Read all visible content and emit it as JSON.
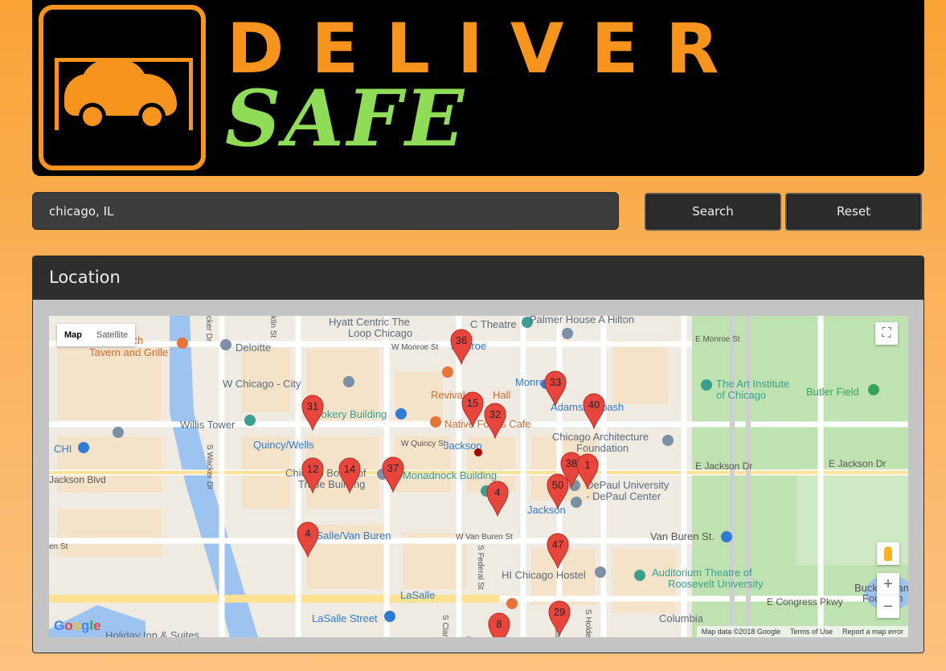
{
  "brand": {
    "line1": "DELIVER",
    "line2": "SAFE",
    "primary_color": "#f7941d",
    "secondary_color": "#8fdc56"
  },
  "search": {
    "value": "chicago, IL",
    "search_label": "Search",
    "reset_label": "Reset"
  },
  "panel": {
    "title": "Location"
  },
  "map": {
    "type_map": "Map",
    "type_satellite": "Satellite",
    "google": "Google",
    "attribution": {
      "data": "Map data ©2018 Google",
      "terms": "Terms of Use",
      "report": "Report a map error"
    },
    "zoom_in": "+",
    "zoom_out": "−",
    "place_labels": [
      "Hyatt Centric The",
      "Loop Chicago",
      "W Monroe St",
      "Monroe",
      "C Theatre",
      "Palmer House A Hilton",
      "Branch",
      "Tavern and Grille",
      "Deloitte",
      "W Chicago - City",
      "Revival",
      "Hall",
      "Monroe",
      "Adams/Wabash",
      "The Art Institute",
      "of Chicago",
      "Butler Field",
      "Rookery Building",
      "Native Foods Cafe",
      "Willis Tower",
      "Chicago Architecture",
      "Foundation",
      "Quincy/Wells",
      "W Quincy St",
      "Jackson",
      "E Jackson Dr",
      "E Jackson Dr",
      "Chicago Board of",
      "Trade Building",
      "Monadnock Building",
      "DePaul University",
      "- DePaul Center",
      "Jackson Blvd",
      "Jackson",
      "LaSalle/Van Buren",
      "W Van Buren St",
      "Van Buren St.",
      "HI Chicago Hostel",
      "Auditorium Theatre of",
      "Roosevelt University",
      "LaSalle",
      "E Congress Pkwy",
      "LaSalle Street",
      "Columbia",
      "Holiday Inn & Suites",
      "Buckingham",
      "Fountain",
      "S Wacker Dr",
      "S Federal St",
      "S Clark St",
      "S State St",
      "S Holden",
      "E Monroe St",
      "CHI",
      "en St",
      "cker Dr",
      "klin St"
    ],
    "markers": [
      "36",
      "33",
      "40",
      "15",
      "32",
      "31",
      "12",
      "14",
      "37",
      "38",
      "1",
      "50",
      "4",
      "4",
      "47",
      "29",
      "8",
      "39"
    ]
  }
}
